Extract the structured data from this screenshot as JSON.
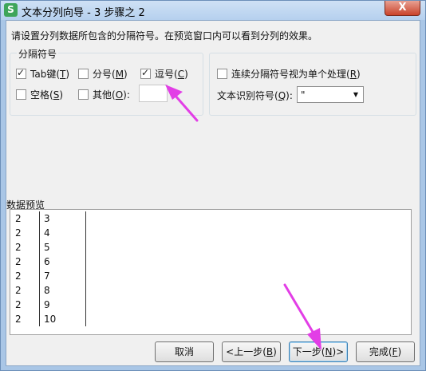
{
  "window": {
    "title": "文本分列向导 - 3 步骤之 2",
    "app_icon_letter": "S",
    "close_label": "X"
  },
  "description": "请设置分列数据所包含的分隔符号。在预览窗口内可以看到分列的效果。",
  "delimiters": {
    "group_label": "分隔符号",
    "tab": {
      "label": "Tab键(",
      "key": "T",
      "checked": true
    },
    "semicolon": {
      "label": "分号(",
      "key": "M",
      "checked": false
    },
    "comma": {
      "label": "逗号(",
      "key": "C",
      "checked": true
    },
    "space": {
      "label": "空格(",
      "key": "S",
      "checked": false
    },
    "other": {
      "label": "其他(",
      "key": "O",
      "checked": false,
      "value": ""
    }
  },
  "options": {
    "consecutive": {
      "label": "连续分隔符号视为单个处理(",
      "key": "R",
      "checked": false
    },
    "text_qualifier": {
      "label": "文本识别符号(",
      "key": "Q",
      "value": "\""
    }
  },
  "preview": {
    "label": "数据预览",
    "rows": [
      [
        "2",
        "3"
      ],
      [
        "2",
        "4"
      ],
      [
        "2",
        "5"
      ],
      [
        "2",
        "6"
      ],
      [
        "2",
        "7"
      ],
      [
        "2",
        "8"
      ],
      [
        "2",
        "9"
      ],
      [
        "2",
        "10"
      ]
    ]
  },
  "buttons": {
    "cancel": "取消",
    "back": "<上一步(",
    "back_key": "B",
    "next": "下一步(",
    "next_key": "N",
    "finish": "完成(",
    "finish_key": "F"
  },
  "annotations": {
    "arrow_color": "#e23ee6"
  }
}
